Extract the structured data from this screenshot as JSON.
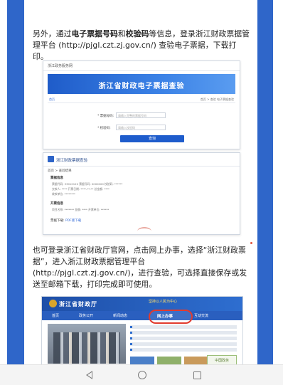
{
  "article": {
    "p1_a": "另外，通过",
    "p1_b1": "电子票据号码",
    "p1_c": "和",
    "p1_b2": "校验码",
    "p1_d": "等信息，登录浙江财政票据管理平台 (http://pjgl.czt.zj.gov.cn/) 查验电子票据，下载打印。",
    "p2": "也可登录浙江省财政厅官网，点击网上办事，选择“浙江财政票据”，进入浙江财政票据管理平台 (http://pjgl.czt.zj.gov.cn/)，进行查验，可选择直接保存或发送至邮箱下载，打印完成即可使用。"
  },
  "shot1": {
    "topbar": "浙江政务服务网",
    "banner": "浙江省财政电子票据查验",
    "nav_left": "首页",
    "nav_right": "首页 > 查验 电子票据查验",
    "field1_label": "* 票据号码:",
    "field1_placeholder": "请输入完整的票据号码",
    "field2_label": "* 校验码:",
    "field2_placeholder": "请输入校验码",
    "button": "查询"
  },
  "shot2": {
    "title": "浙江财政票据查验",
    "breadcrumb": "首页 > 查验结果",
    "section1": "票据信息",
    "line1": "票据代码: 33010120  票据号码: 0000000  校验码: ******",
    "line2": "交款人: ****  开票日期: ****-**-**  总金额: ****",
    "line3": "收款单位: ********",
    "section2": "开票信息",
    "line4": "项目名称: *******  金额: ****   开票单位: ******",
    "footer_label": "票据下载:",
    "footer_link": "PDF版下载"
  },
  "shot3": {
    "title": "浙江省财政厅",
    "slogan": "坚持以人民为中心",
    "menu": [
      "首页",
      "政务公开",
      "新闻动态",
      "网上办事",
      "互动交流"
    ],
    "highlight": "网上办事",
    "badge": "中国政务"
  }
}
